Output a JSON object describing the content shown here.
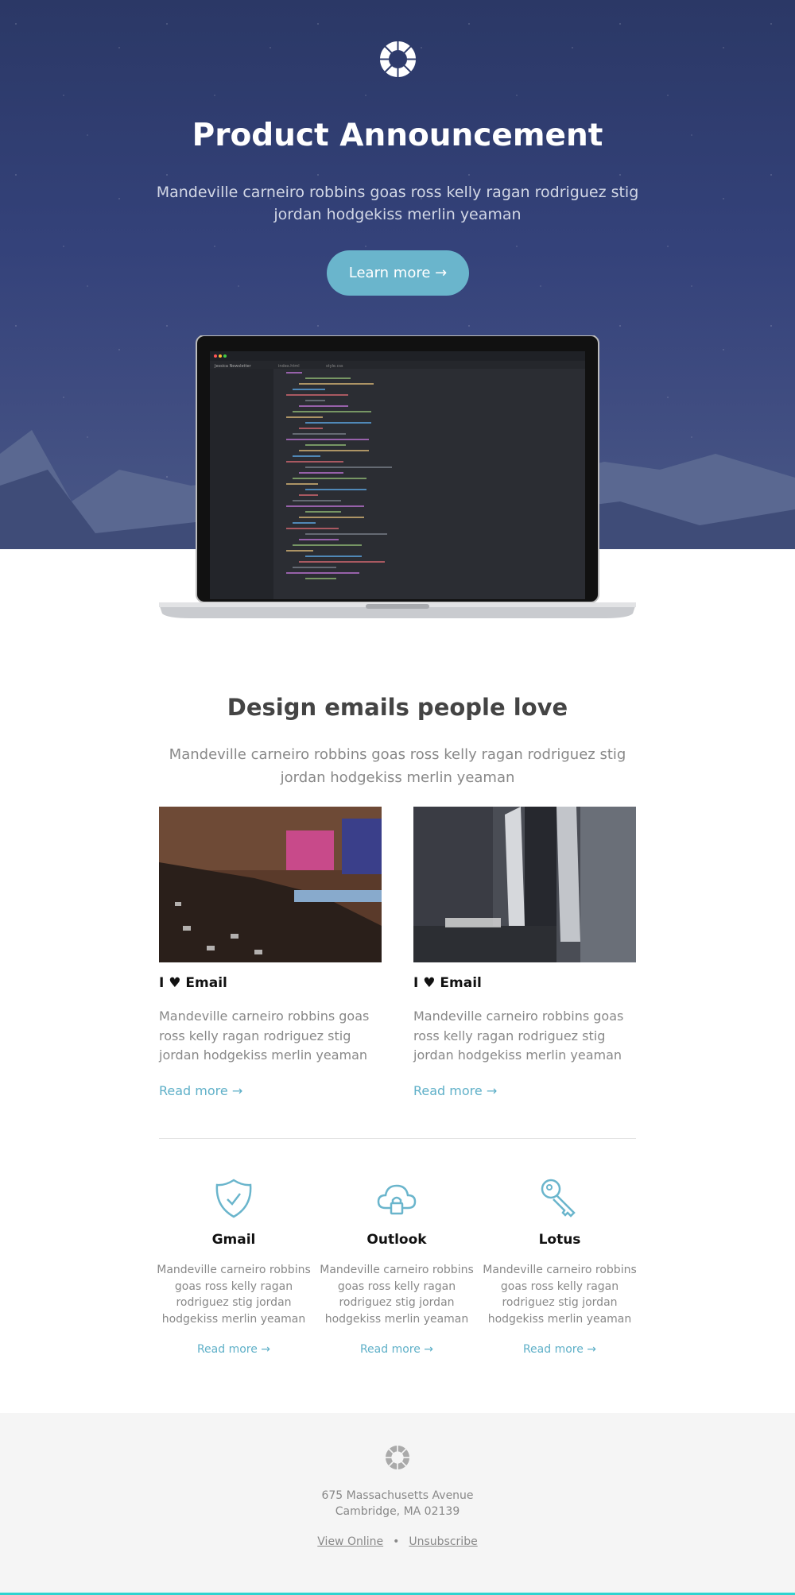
{
  "hero": {
    "title": "Product Announcement",
    "subtitle": "Mandeville carneiro robbins goas ross kelly ragan rodriguez stig jordan hodgekiss merlin yeaman",
    "button": "Learn more →",
    "logo_icon": "wheel-logo-icon",
    "button_color": "#6ab5cc",
    "background_color": "#2b3866"
  },
  "laptop": {
    "window_title": "Jessica Newsletter",
    "tabs": [
      "Jessica Newsletter",
      "index.html",
      "style.css"
    ]
  },
  "intro": {
    "title": "Design emails people love",
    "text": "Mandeville carneiro robbins goas ross kelly ragan rodriguez stig jordan hodgekiss merlin yeaman"
  },
  "cards": [
    {
      "title": "I ♥ Email",
      "text": "Mandeville carneiro robbins goas ross kelly ragan rodriguez stig jordan hodgekiss merlin yeaman",
      "link": "Read more →"
    },
    {
      "title": "I ♥ Email",
      "text": "Mandeville carneiro robbins goas ross kelly ragan rodriguez stig jordan hodgekiss merlin yeaman",
      "link": "Read more →"
    }
  ],
  "features": [
    {
      "icon": "shield-check-icon",
      "title": "Gmail",
      "text": "Mandeville carneiro robbins goas ross kelly ragan rodriguez stig jordan hodgekiss merlin yeaman",
      "link": "Read more →"
    },
    {
      "icon": "cloud-lock-icon",
      "title": "Outlook",
      "text": "Mandeville carneiro robbins goas ross kelly ragan rodriguez stig jordan hodgekiss merlin yeaman",
      "link": "Read more →"
    },
    {
      "icon": "key-icon",
      "title": "Lotus",
      "text": "Mandeville carneiro robbins goas ross kelly ragan rodriguez stig jordan hodgekiss merlin yeaman",
      "link": "Read more →"
    }
  ],
  "footer": {
    "address_line1": "675 Massachusetts Avenue",
    "address_line2": "Cambridge, MA 02139",
    "view_online": "View Online",
    "separator": "•",
    "unsubscribe": "Unsubscribe"
  },
  "accent_color": "#5fb0c8"
}
